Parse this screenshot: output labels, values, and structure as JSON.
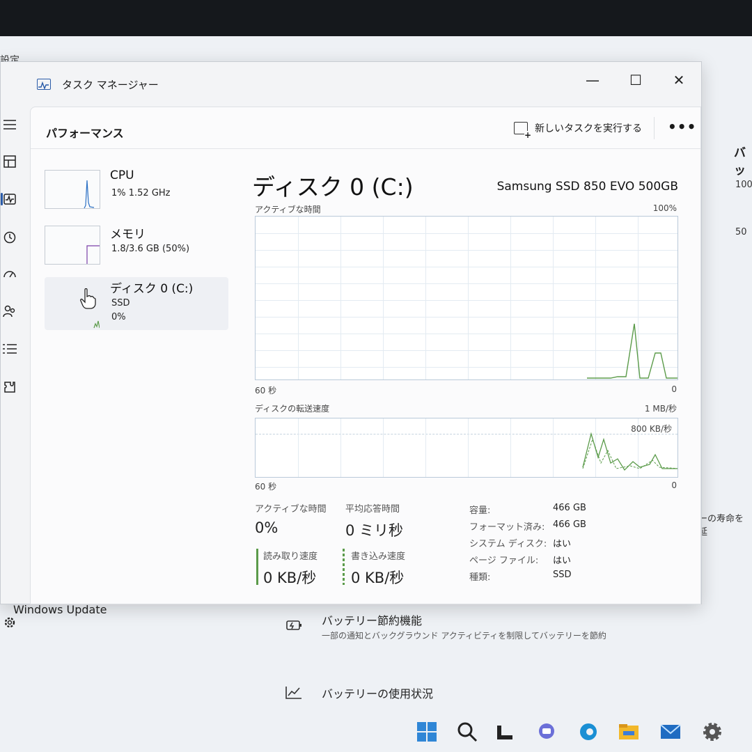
{
  "background": {
    "settings_label": "設定",
    "right_title": "バッ",
    "right_value_1": "100",
    "right_value_2": "50",
    "windows_update": "Windows Update",
    "battery_saver_title": "バッテリー節約機能",
    "battery_saver_sub": "一部の通知とバックグラウンド アクティビティを制限してバッテリーを節約",
    "battery_usage_title": "バッテリーの使用状況",
    "lifespan_text": "ーの寿命を延"
  },
  "window": {
    "title": "タスク マネージャー",
    "minimize": "—",
    "maximize": "☐",
    "close": "✕"
  },
  "header": {
    "title": "パフォーマンス",
    "run_task": "新しいタスクを実行する",
    "more": "•••"
  },
  "devices": [
    {
      "name": "CPU",
      "line1": "1%  1.52 GHz",
      "line2": ""
    },
    {
      "name": "メモリ",
      "line1": "1.8/3.6 GB (50%)",
      "line2": ""
    },
    {
      "name": "ディスク 0 (C:)",
      "line1": "SSD",
      "line2": "0%"
    }
  ],
  "detail": {
    "title": "ディスク 0 (C:)",
    "model": "Samsung SSD 850 EVO 500GB",
    "active_caption": "アクティブな時間",
    "active_max": "100%",
    "active_time_span": "60 秒",
    "active_min": "0",
    "transfer_caption": "ディスクの転送速度",
    "transfer_max": "1 MB/秒",
    "transfer_inner": "800 KB/秒",
    "transfer_time_span": "60 秒",
    "transfer_min": "0"
  },
  "stats": {
    "active_time_label": "アクティブな時間",
    "active_time_value": "0%",
    "response_label": "平均応答時間",
    "response_value": "0 ミリ秒",
    "read_label": "読み取り速度",
    "read_value": "0 KB/秒",
    "write_label": "書き込み速度",
    "write_value": "0 KB/秒"
  },
  "properties": [
    {
      "key": "容量:",
      "value": "466 GB"
    },
    {
      "key": "フォーマット済み:",
      "value": "466 GB"
    },
    {
      "key": "システム ディスク:",
      "value": "はい"
    },
    {
      "key": "ページ ファイル:",
      "value": "はい"
    },
    {
      "key": "種類:",
      "value": "SSD"
    }
  ],
  "colors": {
    "accent": "#2a5ba8",
    "graph_line": "#5b9b4a",
    "graph_border": "#b9c9d9"
  },
  "icons": {
    "nav": [
      "hamburger-menu-icon",
      "processes-icon",
      "performance-icon",
      "app-history-icon",
      "startup-apps-icon",
      "users-icon",
      "details-icon",
      "services-icon",
      "settings-icon"
    ],
    "taskbar": [
      "start-icon",
      "search-icon",
      "widgets-icon",
      "chat-icon",
      "edge-icon",
      "file-explorer-icon",
      "mail-icon",
      "settings-gear-icon"
    ]
  }
}
